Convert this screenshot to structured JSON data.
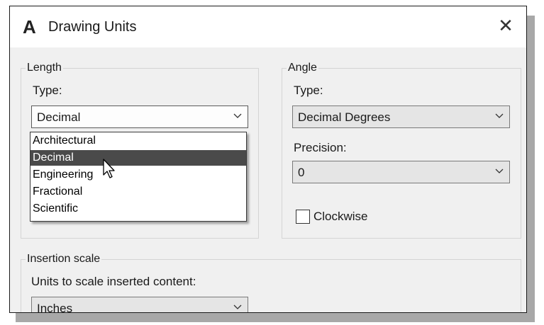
{
  "dialog": {
    "app_icon": "A",
    "title": "Drawing Units",
    "close_glyph": "✕"
  },
  "length": {
    "legend": "Length",
    "type_label": "Type:",
    "type_value": "Decimal",
    "options": [
      "Architectural",
      "Decimal",
      "Engineering",
      "Fractional",
      "Scientific"
    ],
    "highlighted_option": "Decimal"
  },
  "angle": {
    "legend": "Angle",
    "type_label": "Type:",
    "type_value": "Decimal Degrees",
    "precision_label": "Precision:",
    "precision_value": "0",
    "clockwise_label": "Clockwise",
    "clockwise_checked": false
  },
  "insertion": {
    "legend": "Insertion scale",
    "units_label": "Units to scale inserted content:",
    "units_value": "Inches"
  },
  "icons": {
    "dropdown_arrow": "chevron-down-icon",
    "cursor": "mouse-pointer-icon"
  }
}
